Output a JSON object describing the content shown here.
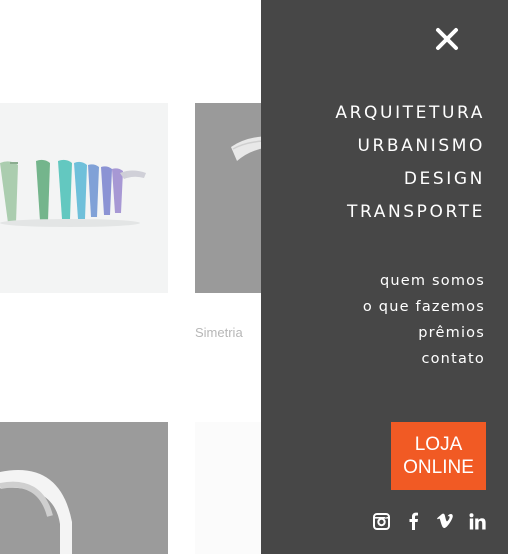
{
  "gallery": {
    "caption": "Simetria"
  },
  "menu": {
    "close_icon": "close-icon",
    "primary": [
      {
        "label": "ARQUITETURA"
      },
      {
        "label": "URBANISMO"
      },
      {
        "label": "DESIGN"
      },
      {
        "label": "TRANSPORTE"
      }
    ],
    "secondary": [
      {
        "label": "quem somos"
      },
      {
        "label": "o que fazemos"
      },
      {
        "label": "prêmios"
      },
      {
        "label": "contato"
      }
    ],
    "shop": {
      "line1": "LOJA",
      "line2": "ONLINE"
    },
    "social": [
      "instagram-icon",
      "facebook-icon",
      "vimeo-icon",
      "linkedin-icon"
    ]
  },
  "colors": {
    "panel": "#474747",
    "accent": "#f15a24",
    "text": "#ffffff"
  }
}
